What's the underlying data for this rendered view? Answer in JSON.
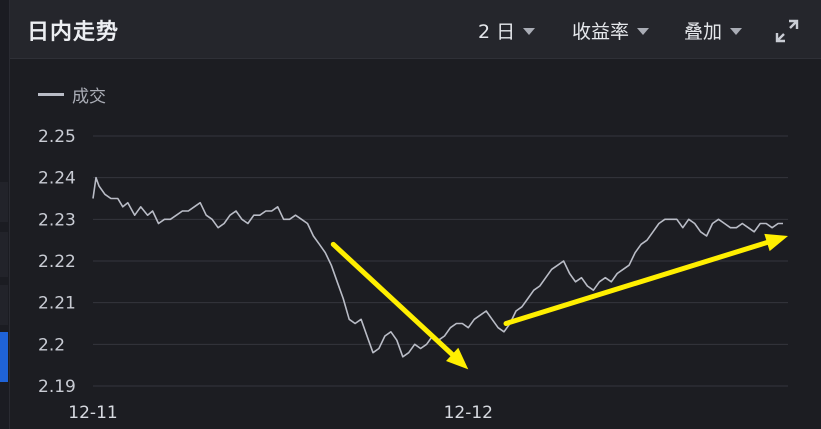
{
  "header": {
    "title": "日内走势",
    "period_label": "2 日",
    "metric_label": "收益率",
    "overlay_label": "叠加",
    "expand_icon": "expand-icon"
  },
  "colors": {
    "line": "#b9bcc6",
    "grid": "#34353d",
    "annotation": "#ffef00",
    "background": "#1c1d22"
  },
  "chart_data": {
    "type": "line",
    "legend": [
      "成交"
    ],
    "ylim": [
      2.19,
      2.25
    ],
    "yticks": [
      "2.25",
      "2.24",
      "2.23",
      "2.22",
      "2.21",
      "2.2",
      "2.19"
    ],
    "xticks": [
      "12-11",
      "12-12"
    ],
    "grid": true,
    "series": [
      {
        "name": "成交",
        "x": [
          0,
          3,
          6,
          12,
          18,
          25,
          30,
          35,
          42,
          48,
          55,
          60,
          66,
          72,
          78,
          84,
          90,
          96,
          102,
          108,
          114,
          120,
          126,
          132,
          138,
          144,
          150,
          156,
          162,
          168,
          174,
          180,
          186,
          192,
          198,
          204,
          210,
          216,
          222,
          228,
          234,
          240,
          246,
          252,
          258,
          264,
          270,
          276,
          282,
          288,
          294,
          300,
          306,
          312,
          318,
          324,
          330,
          336,
          342,
          348,
          354,
          360,
          366,
          372,
          378,
          384,
          390,
          396,
          402,
          408,
          414,
          420,
          426,
          432,
          438,
          444,
          450,
          456,
          462,
          468,
          474,
          480,
          486,
          492,
          498,
          504,
          510,
          516,
          522,
          528,
          534,
          540,
          546,
          552,
          558,
          564,
          570,
          576,
          582,
          588,
          594,
          600,
          606,
          612,
          618,
          624,
          630,
          636,
          642,
          648,
          654,
          660,
          666,
          672,
          678,
          684,
          690,
          695
        ],
        "values": [
          2.235,
          2.24,
          2.238,
          2.236,
          2.235,
          2.235,
          2.233,
          2.234,
          2.231,
          2.233,
          2.231,
          2.232,
          2.229,
          2.23,
          2.23,
          2.231,
          2.232,
          2.232,
          2.233,
          2.234,
          2.231,
          2.23,
          2.228,
          2.229,
          2.231,
          2.232,
          2.23,
          2.229,
          2.231,
          2.231,
          2.232,
          2.232,
          2.233,
          2.23,
          2.23,
          2.231,
          2.23,
          2.229,
          2.226,
          2.224,
          2.222,
          2.219,
          2.215,
          2.211,
          2.206,
          2.205,
          2.206,
          2.202,
          2.198,
          2.199,
          2.202,
          2.203,
          2.201,
          2.197,
          2.198,
          2.2,
          2.199,
          2.2,
          2.202,
          2.201,
          2.202,
          2.204,
          2.205,
          2.205,
          2.204,
          2.206,
          2.207,
          2.208,
          2.206,
          2.204,
          2.203,
          2.205,
          2.208,
          2.209,
          2.211,
          2.213,
          2.214,
          2.216,
          2.218,
          2.219,
          2.22,
          2.217,
          2.215,
          2.216,
          2.214,
          2.213,
          2.215,
          2.216,
          2.215,
          2.217,
          2.218,
          2.219,
          2.222,
          2.224,
          2.225,
          2.227,
          2.229,
          2.23,
          2.23,
          2.23,
          2.228,
          2.23,
          2.229,
          2.227,
          2.226,
          2.229,
          2.23,
          2.229,
          2.228,
          2.228,
          2.229,
          2.228,
          2.227,
          2.229,
          2.229,
          2.228,
          2.229,
          2.229
        ]
      }
    ],
    "annotations": [
      {
        "type": "arrow",
        "from": [
          242,
          2.224
        ],
        "to": [
          378,
          2.194
        ]
      },
      {
        "type": "arrow",
        "from": [
          416,
          2.205
        ],
        "to": [
          700,
          2.226
        ]
      }
    ],
    "x_range": [
      0,
      700
    ],
    "xtick_positions": [
      0,
      378
    ]
  }
}
